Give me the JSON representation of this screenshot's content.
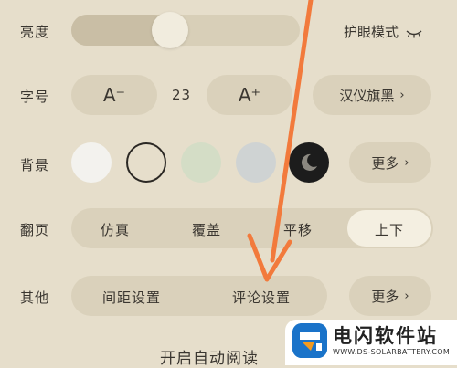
{
  "brightness": {
    "label": "亮度",
    "level": 0.42,
    "eye_care_label": "护眼模式",
    "eye_icon": "closed-eye-icon"
  },
  "font_size": {
    "label": "字号",
    "decrease_label": "A⁻",
    "value": "23",
    "increase_label": "A⁺",
    "font_name": "汉仪旗黑",
    "chevron": "›"
  },
  "background": {
    "label": "背景",
    "swatches": [
      {
        "name": "white",
        "color": "#f3f2ee"
      },
      {
        "name": "beige",
        "color": "#e6decb"
      },
      {
        "name": "green",
        "color": "#d4ddc6"
      },
      {
        "name": "blue",
        "color": "#cfd3d3"
      },
      {
        "name": "night",
        "color": "#1c1c1c"
      }
    ],
    "selected_index": 1,
    "more_label": "更多",
    "chevron": "›"
  },
  "page_turn": {
    "label": "翻页",
    "options": [
      "仿真",
      "覆盖",
      "平移",
      "上下"
    ],
    "selected_index": 3
  },
  "other": {
    "label": "其他",
    "spacing_label": "间距设置",
    "comment_label": "评论设置",
    "more_label": "更多",
    "chevron": "›"
  },
  "auto_read_label": "开启自动阅读",
  "colors": {
    "background": "#e6decb",
    "pill": "#dad1bb",
    "selected": "#f4efe1",
    "arrow": "#f27a3c",
    "text": "#3a3630"
  },
  "watermark": {
    "title": "电闪软件站",
    "url": "WWW.DS-SOLARBATTERY.COM"
  }
}
